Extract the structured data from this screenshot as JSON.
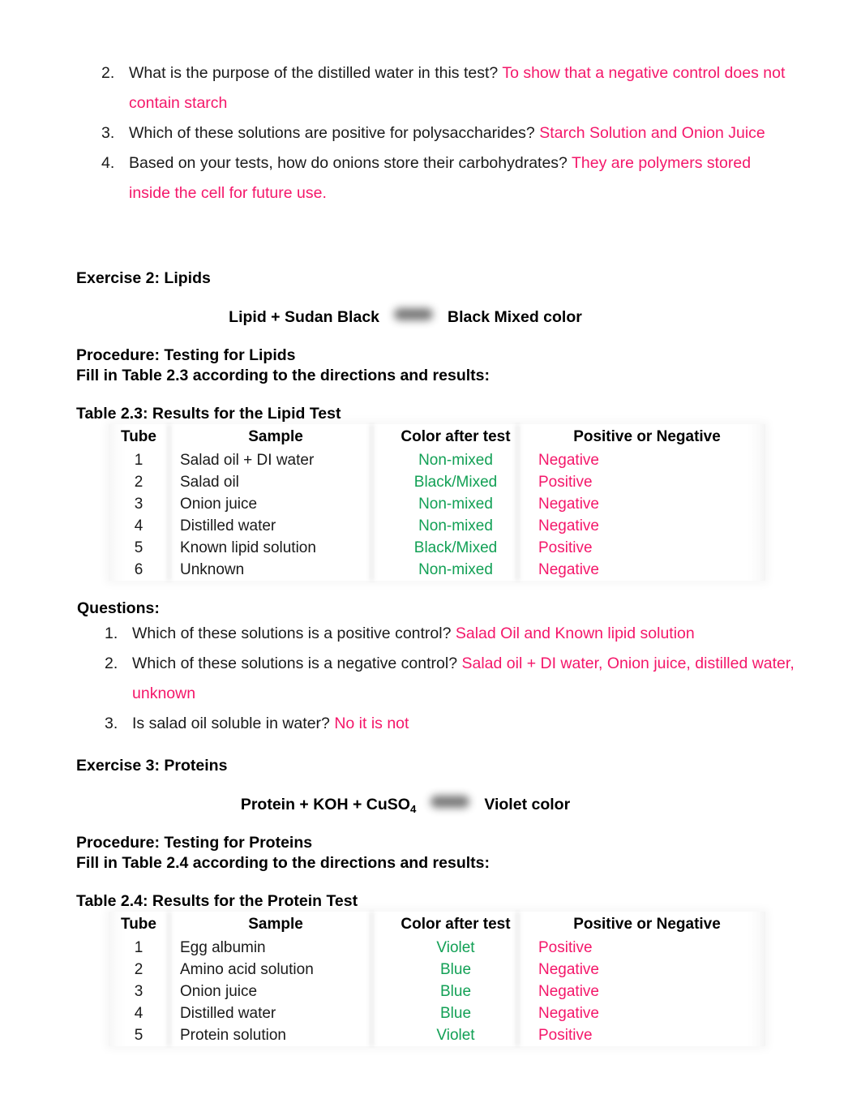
{
  "top_questions": [
    {
      "number": "2.",
      "question": "What is the purpose of the distilled water in this test?",
      "answer": "To show that a negative control does not contain starch"
    },
    {
      "number": "3.",
      "question": "Which of these solutions are positive for polysaccharides?",
      "answer": "Starch Solution and Onion Juice"
    },
    {
      "number": "4.",
      "question": "Based on your tests, how do onions store their carbohydrates?",
      "answer": "They are polymers stored inside the cell for future use."
    }
  ],
  "exercise2": {
    "heading": "Exercise 2: Lipids",
    "equation_left": "Lipid + Sudan Black",
    "equation_right": "Black Mixed color",
    "procedure_line1": "Procedure: Testing for Lipids",
    "procedure_line2": "Fill in Table 2.3 according to the directions and results:",
    "table_caption": "Table 2.3: Results for the Lipid Test",
    "table": {
      "headers": [
        "Tube",
        "Sample",
        "Color after test",
        "Positive or Negative"
      ],
      "rows": [
        [
          "1",
          "Salad oil + DI water",
          "Non-mixed",
          "Negative"
        ],
        [
          "2",
          "Salad oil",
          "Black/Mixed",
          "Positive"
        ],
        [
          "3",
          "Onion juice",
          "Non-mixed",
          "Negative"
        ],
        [
          "4",
          "Distilled water",
          "Non-mixed",
          "Negative"
        ],
        [
          "5",
          "Known lipid solution",
          "Black/Mixed",
          "Positive"
        ],
        [
          "6",
          "Unknown",
          "Non-mixed",
          "Negative"
        ]
      ]
    },
    "questions_heading": "Questions:",
    "questions": [
      {
        "number": "1.",
        "question": "Which of these solutions is a positive control?",
        "answer": "Salad Oil and Known lipid solution"
      },
      {
        "number": "2.",
        "question": "Which of these solutions is a negative control?",
        "answer": "Salad oil + DI water, Onion juice, distilled water, unknown"
      },
      {
        "number": "3.",
        "question": "Is salad oil soluble in water?",
        "answer": "No it is not"
      }
    ]
  },
  "exercise3": {
    "heading": "Exercise 3: Proteins",
    "equation_left_a": "Protein + KOH + CuSO",
    "equation_left_sub": "4",
    "equation_right": "Violet color",
    "procedure_line1": "Procedure: Testing for Proteins",
    "procedure_line2": "Fill in Table 2.4 according to the directions and results:",
    "table_caption": "Table 2.4: Results for the Protein Test",
    "table": {
      "headers": [
        "Tube",
        "Sample",
        "Color after test",
        "Positive or Negative"
      ],
      "rows": [
        [
          "1",
          "Egg albumin",
          "Violet",
          "Positive"
        ],
        [
          "2",
          "Amino acid solution",
          "Blue",
          "Negative"
        ],
        [
          "3",
          "Onion juice",
          "Blue",
          "Negative"
        ],
        [
          "4",
          "Distilled water",
          "Blue",
          "Negative"
        ],
        [
          "5",
          "Protein solution",
          "Violet",
          "Positive"
        ]
      ]
    }
  },
  "colors": {
    "answer_pink": "#f4176a",
    "result_green": "#12a055",
    "body_text": "#1a1a1a"
  }
}
